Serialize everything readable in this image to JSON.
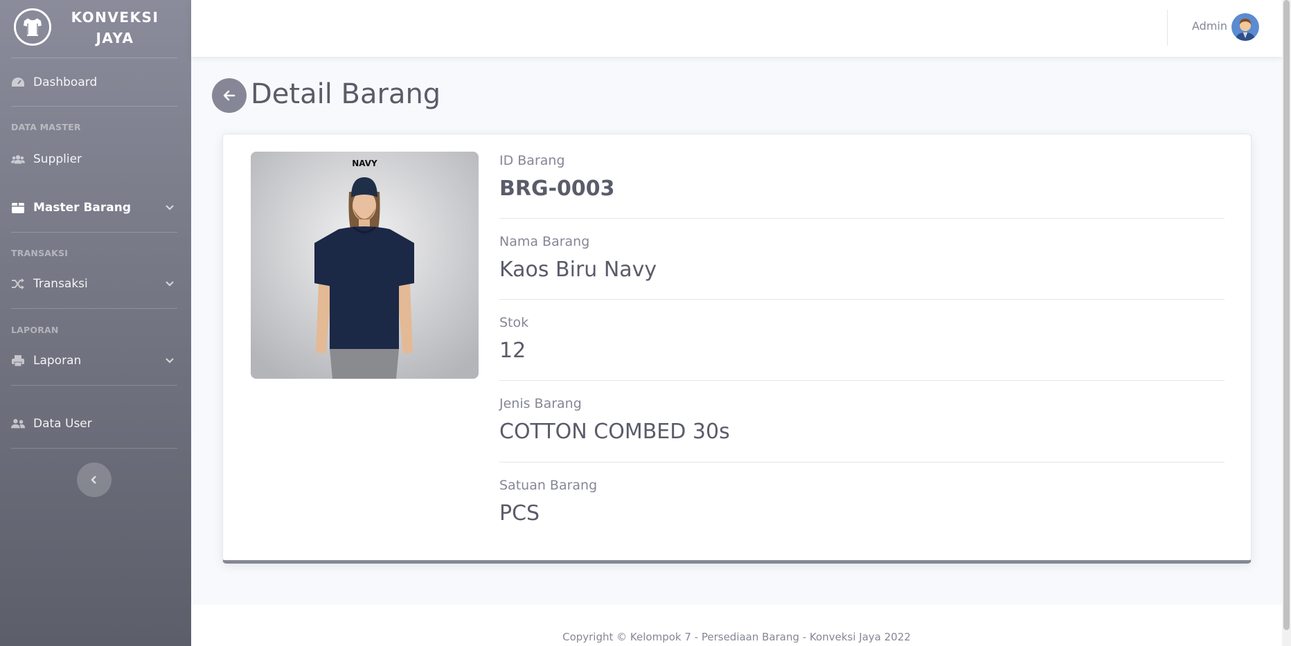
{
  "brand": {
    "line1": "KONVEKSI",
    "line2": "JAYA"
  },
  "sidebar": {
    "dashboard": "Dashboard",
    "heading_data_master": "DATA MASTER",
    "supplier": "Supplier",
    "master_barang": "Master Barang",
    "heading_transaksi": "TRANSAKSI",
    "transaksi": "Transaksi",
    "heading_laporan": "LAPORAN",
    "laporan": "Laporan",
    "data_user": "Data User"
  },
  "topbar": {
    "user_name": "Admin"
  },
  "page": {
    "title": "Detail Barang"
  },
  "product": {
    "image_caption": "NAVY",
    "fields": [
      {
        "label": "ID Barang",
        "value": "BRG-0003"
      },
      {
        "label": "Nama Barang",
        "value": "Kaos Biru Navy"
      },
      {
        "label": "Stok",
        "value": "12"
      },
      {
        "label": "Jenis Barang",
        "value": "COTTON COMBED 30s"
      },
      {
        "label": "Satuan Barang",
        "value": "PCS"
      }
    ]
  },
  "footer": {
    "text": "Copyright © Kelompok 7 - Persediaan Barang - Konveksi Jaya 2022"
  },
  "colors": {
    "sidebar": "#858796",
    "accent": "#858796",
    "text": "#5a5c69"
  },
  "icons": [
    "tshirt-icon",
    "tachometer-icon",
    "users-icon",
    "box-icon",
    "chevron-down-icon",
    "random-icon",
    "print-icon",
    "user-friends-icon",
    "chevron-left-icon",
    "arrow-left-icon"
  ]
}
